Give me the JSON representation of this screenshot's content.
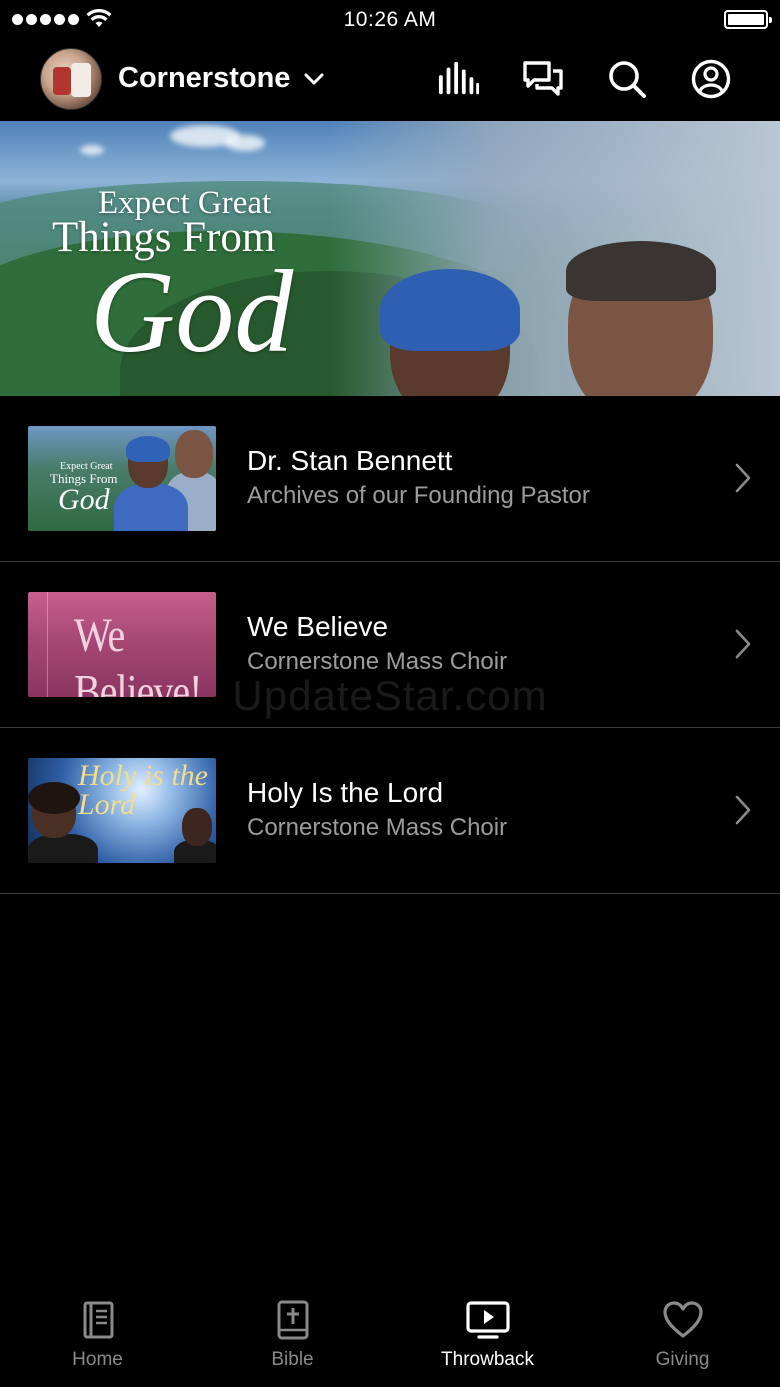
{
  "status_bar": {
    "time": "10:26 AM"
  },
  "header": {
    "app_name": "Cornerstone"
  },
  "hero": {
    "line1": "Expect Great",
    "line2": "Things From",
    "line3": "God"
  },
  "list": [
    {
      "title": "Dr. Stan Bennett",
      "subtitle": "Archives of our Founding Pastor",
      "thumb": {
        "a": "Expect Great",
        "b": "Things From",
        "c": "God"
      }
    },
    {
      "title": "We Believe",
      "subtitle": "Cornerstone Mass Choir",
      "thumb": {
        "text": "We Believe!"
      }
    },
    {
      "title": "Holy Is the Lord",
      "subtitle": "Cornerstone Mass Choir",
      "thumb": {
        "text": "Holy is the Lord"
      }
    }
  ],
  "watermark": "UpdateStar.com",
  "tabs": [
    {
      "label": "Home",
      "icon": "book-icon",
      "active": false
    },
    {
      "label": "Bible",
      "icon": "bible-icon",
      "active": false
    },
    {
      "label": "Throwback",
      "icon": "play-screen-icon",
      "active": true
    },
    {
      "label": "Giving",
      "icon": "heart-icon",
      "active": false
    }
  ],
  "colors": {
    "background": "#000000",
    "active_tab": "#ffffff",
    "inactive_tab": "#8a8a8a",
    "subtitle": "#9c9c9c"
  }
}
